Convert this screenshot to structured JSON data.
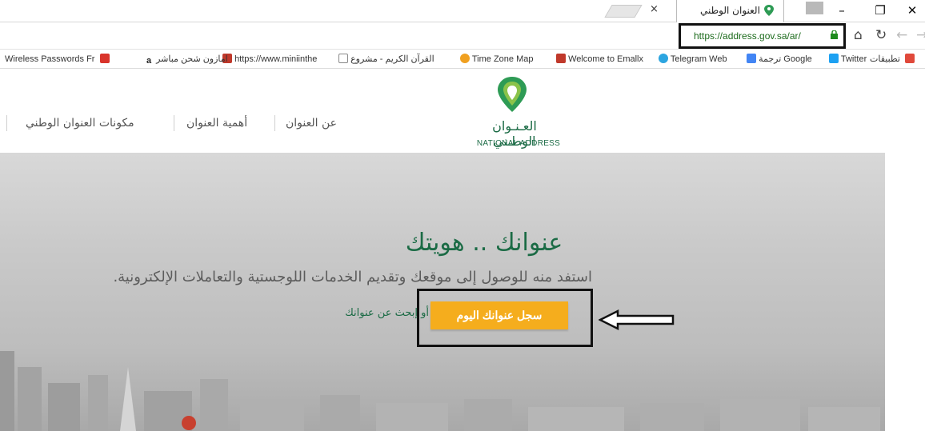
{
  "browser": {
    "tab_title": "العنوان الوطني",
    "tab_close": "×",
    "url": "https://address.gov.sa/ar/",
    "window_controls": {
      "minimize": "–",
      "restore": "❐",
      "close": "✕"
    }
  },
  "bookmarks": [
    {
      "label": "تطبيقات",
      "icon": "apps-icon",
      "color": "#e0493b"
    },
    {
      "label": "Twitter",
      "icon": "twitter-icon",
      "color": "#1da1f2"
    },
    {
      "label": "ترجمة Google",
      "icon": "google-translate-icon",
      "color": "#4285f4"
    },
    {
      "label": "Telegram Web",
      "icon": "telegram-icon",
      "color": "#2ca5e0"
    },
    {
      "label": "Welcome to Emallx",
      "icon": "emallx-icon",
      "color": "#c0392b"
    },
    {
      "label": "Time Zone Map",
      "icon": "timezone-icon",
      "color": "#f0a020"
    },
    {
      "label": "القرآن الكريم - مشروع",
      "icon": "page-icon",
      "color": "#888888"
    },
    {
      "label": "https://www.miniinthe",
      "icon": "bars-icon",
      "color": "#c0392b"
    },
    {
      "label": "امازون شحن مباشر",
      "icon": "amazon-icon",
      "color": "#222222"
    },
    {
      "label": "Wireless Passwords Fr",
      "icon": "wireless-icon",
      "color": "#d9342b"
    }
  ],
  "site": {
    "logo_ar": "العـنـوان الوطـني",
    "logo_en": "NATIONAL ADDRESS",
    "menu": [
      "عن العنوان",
      "أهمية العنوان",
      "مكونات العنوان الوطني"
    ],
    "brand_color": "#1b6b45"
  },
  "hero": {
    "title": "عنوانك .. هويتك",
    "subtitle": "استفد منه للوصول إلى موقعك وتقديم الخدمات اللوجستية والتعاملات الإلكترونية.",
    "cta": "سجل عنوانك اليوم",
    "search_link": "أو إبحث عن عنوانك",
    "cta_color": "#f5ad1d"
  }
}
